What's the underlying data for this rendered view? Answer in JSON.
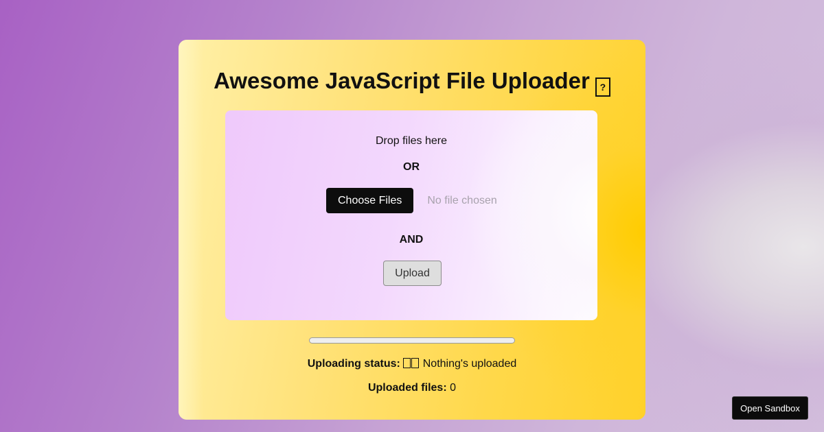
{
  "title": "Awesome JavaScript File Uploader",
  "title_icon": "rocket-icon",
  "dropzone": {
    "drop_text": "Drop files here",
    "or_text": "OR",
    "choose_button": "Choose Files",
    "no_file_text": "No file chosen",
    "and_text": "AND",
    "upload_button": "Upload"
  },
  "progress": {
    "value": 0
  },
  "status": {
    "label": "Uploading status:",
    "icon": "empty-box-icon",
    "text": "Nothing's uploaded"
  },
  "uploaded": {
    "label": "Uploaded files:",
    "count": "0"
  },
  "sandbox_button": "Open Sandbox",
  "colors": {
    "card_accent": "#ffcc00",
    "dropzone_tint": "#efc9fb",
    "button_dark": "#0d0d0d"
  }
}
